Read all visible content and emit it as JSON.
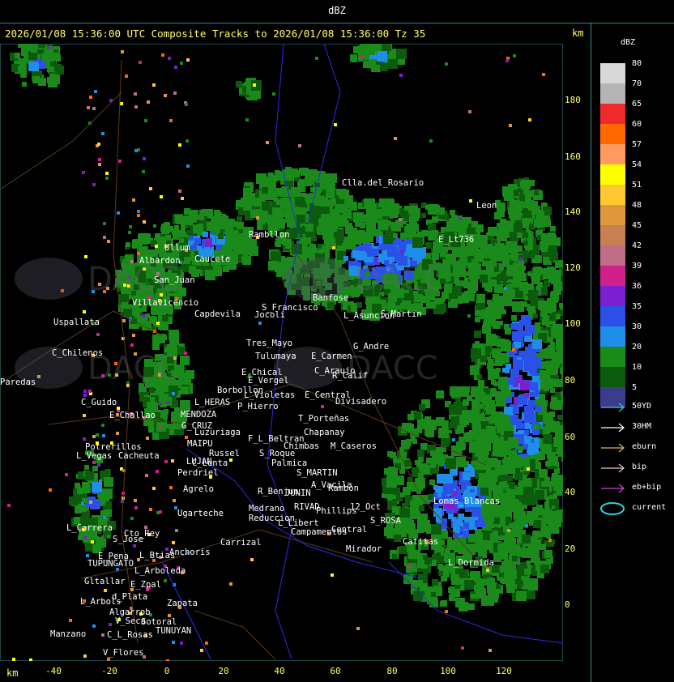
{
  "topbar_title": "dBZ",
  "header_text": "2026/01/08 15:36:00 UTC Composite Tracks to 2026/01/08 15:36:00 Tz 35",
  "km_label": "km",
  "axes": {
    "y_ticks": [
      180,
      160,
      140,
      120,
      100,
      80,
      60,
      40,
      20,
      0
    ],
    "x_ticks": [
      -40,
      -20,
      0,
      20,
      40,
      60,
      80,
      100,
      120
    ]
  },
  "legend": {
    "title": "dBZ",
    "entries": [
      {
        "label": "80",
        "color": "#d8d8d8"
      },
      {
        "label": "70",
        "color": "#b4b4b4"
      },
      {
        "label": "65",
        "color": "#ee2a2a"
      },
      {
        "label": "60",
        "color": "#ff6a00"
      },
      {
        "label": "57",
        "color": "#ff9a60"
      },
      {
        "label": "54",
        "color": "#ffff00"
      },
      {
        "label": "51",
        "color": "#ffc830"
      },
      {
        "label": "48",
        "color": "#e0963c"
      },
      {
        "label": "45",
        "color": "#c88050"
      },
      {
        "label": "42",
        "color": "#c06e88"
      },
      {
        "label": "39",
        "color": "#d0208c"
      },
      {
        "label": "36",
        "color": "#7a20d0"
      },
      {
        "label": "35",
        "color": "#2a50e8"
      },
      {
        "label": "30",
        "color": "#1e8ee8"
      },
      {
        "label": "20",
        "color": "#1a8a1a"
      },
      {
        "label": "10",
        "color": "#0c5a0c"
      },
      {
        "label": "5",
        "color": "#3c3c8c"
      }
    ],
    "tracks": [
      {
        "label": "50YD",
        "color": "#40c8d0"
      },
      {
        "label": "30HM",
        "color": "#ffffff"
      },
      {
        "label": "eburn",
        "color": "#e0b070"
      },
      {
        "label": "bip",
        "color": "#f0c0d0"
      },
      {
        "label": "eb+bip",
        "color": "#d040d0"
      },
      {
        "label": "current",
        "color": "#30d0e0"
      }
    ]
  },
  "places": [
    {
      "name": "Clla.del_Rosario"
    },
    {
      "name": "Rambllon"
    },
    {
      "name": "Ullum"
    },
    {
      "name": "Albardon"
    },
    {
      "name": "Caucete"
    },
    {
      "name": "San_Juan"
    },
    {
      "name": "Villavicencio"
    },
    {
      "name": "Capdevila"
    },
    {
      "name": "Uspallata"
    },
    {
      "name": "S_Francisco"
    },
    {
      "name": "Jocoli"
    },
    {
      "name": "Tres_Mayo"
    },
    {
      "name": "Tulumaya"
    },
    {
      "name": "E_Carmen"
    },
    {
      "name": "G_Andre"
    },
    {
      "name": "Banfose"
    },
    {
      "name": "L_Asuncion"
    },
    {
      "name": "C_Chilenos"
    },
    {
      "name": "E_Chical"
    },
    {
      "name": "E_Vergel"
    },
    {
      "name": "C_Araujo"
    },
    {
      "name": "R_Calif"
    },
    {
      "name": "Borbollon"
    },
    {
      "name": "L_Violetas"
    },
    {
      "name": "E_Central"
    },
    {
      "name": "Divisadero"
    },
    {
      "name": "P_Hierro"
    },
    {
      "name": "L_HERAS"
    },
    {
      "name": "C_Guido"
    },
    {
      "name": "E_Challao"
    },
    {
      "name": "MENDOZA"
    },
    {
      "name": "T_Porteñas"
    },
    {
      "name": "G_CRUZ"
    },
    {
      "name": "Luzuriaga"
    },
    {
      "name": "Chapanay"
    },
    {
      "name": "F_L_Beltran"
    },
    {
      "name": "Chimbas"
    },
    {
      "name": "M_Caseros"
    },
    {
      "name": "Potrerillos"
    },
    {
      "name": "L_Vegas"
    },
    {
      "name": "Cacheuta"
    },
    {
      "name": "MAIPU"
    },
    {
      "name": "Russel"
    },
    {
      "name": "S_Roque"
    },
    {
      "name": "Palmica"
    },
    {
      "name": "LUJAN"
    },
    {
      "name": "C_Lunta"
    },
    {
      "name": "Perdriel"
    },
    {
      "name": "S_MARTIN"
    },
    {
      "name": "A_Vacila"
    },
    {
      "name": "Rambon"
    },
    {
      "name": "Agrelo"
    },
    {
      "name": "R_Benjun"
    },
    {
      "name": "JUNIN"
    },
    {
      "name": "RIVAD"
    },
    {
      "name": "Phillips"
    },
    {
      "name": "12_Oct"
    },
    {
      "name": "Lomas_Blancas"
    },
    {
      "name": "Ugarteche"
    },
    {
      "name": "Medrano"
    },
    {
      "name": "Reduccion"
    },
    {
      "name": "L_Libert"
    },
    {
      "name": "S_ROSA"
    },
    {
      "name": "Campamentos"
    },
    {
      "name": "Central"
    },
    {
      "name": "L_Carrera"
    },
    {
      "name": "Cto_Rey"
    },
    {
      "name": "S_Jose"
    },
    {
      "name": "Carrizal"
    },
    {
      "name": "Catitas"
    },
    {
      "name": "Anchoris"
    },
    {
      "name": "E_Pena"
    },
    {
      "name": "L_Btias"
    },
    {
      "name": "TUPUNGATO"
    },
    {
      "name": "Mirador"
    },
    {
      "name": "L_Dormida"
    },
    {
      "name": "L_Arboleda"
    },
    {
      "name": "Gltallar"
    },
    {
      "name": "E_Zpal"
    },
    {
      "name": "d_Plata"
    },
    {
      "name": "L_Arbols"
    },
    {
      "name": "Zapata"
    },
    {
      "name": "Algarrob"
    },
    {
      "name": "V_Seca"
    },
    {
      "name": "Sotoral"
    },
    {
      "name": "TUNUYAN"
    },
    {
      "name": "Manzano"
    },
    {
      "name": "C_L_Rosas"
    },
    {
      "name": "V_Flores"
    },
    {
      "name": "Paredas"
    },
    {
      "name": "Leon"
    },
    {
      "name": "E_Lt736"
    },
    {
      "name": "S_Martin"
    }
  ],
  "watermarks": [
    {
      "name": "DACC"
    },
    {
      "name": "DACC"
    },
    {
      "name": "DACC"
    },
    {
      "name": "DACC"
    }
  ]
}
